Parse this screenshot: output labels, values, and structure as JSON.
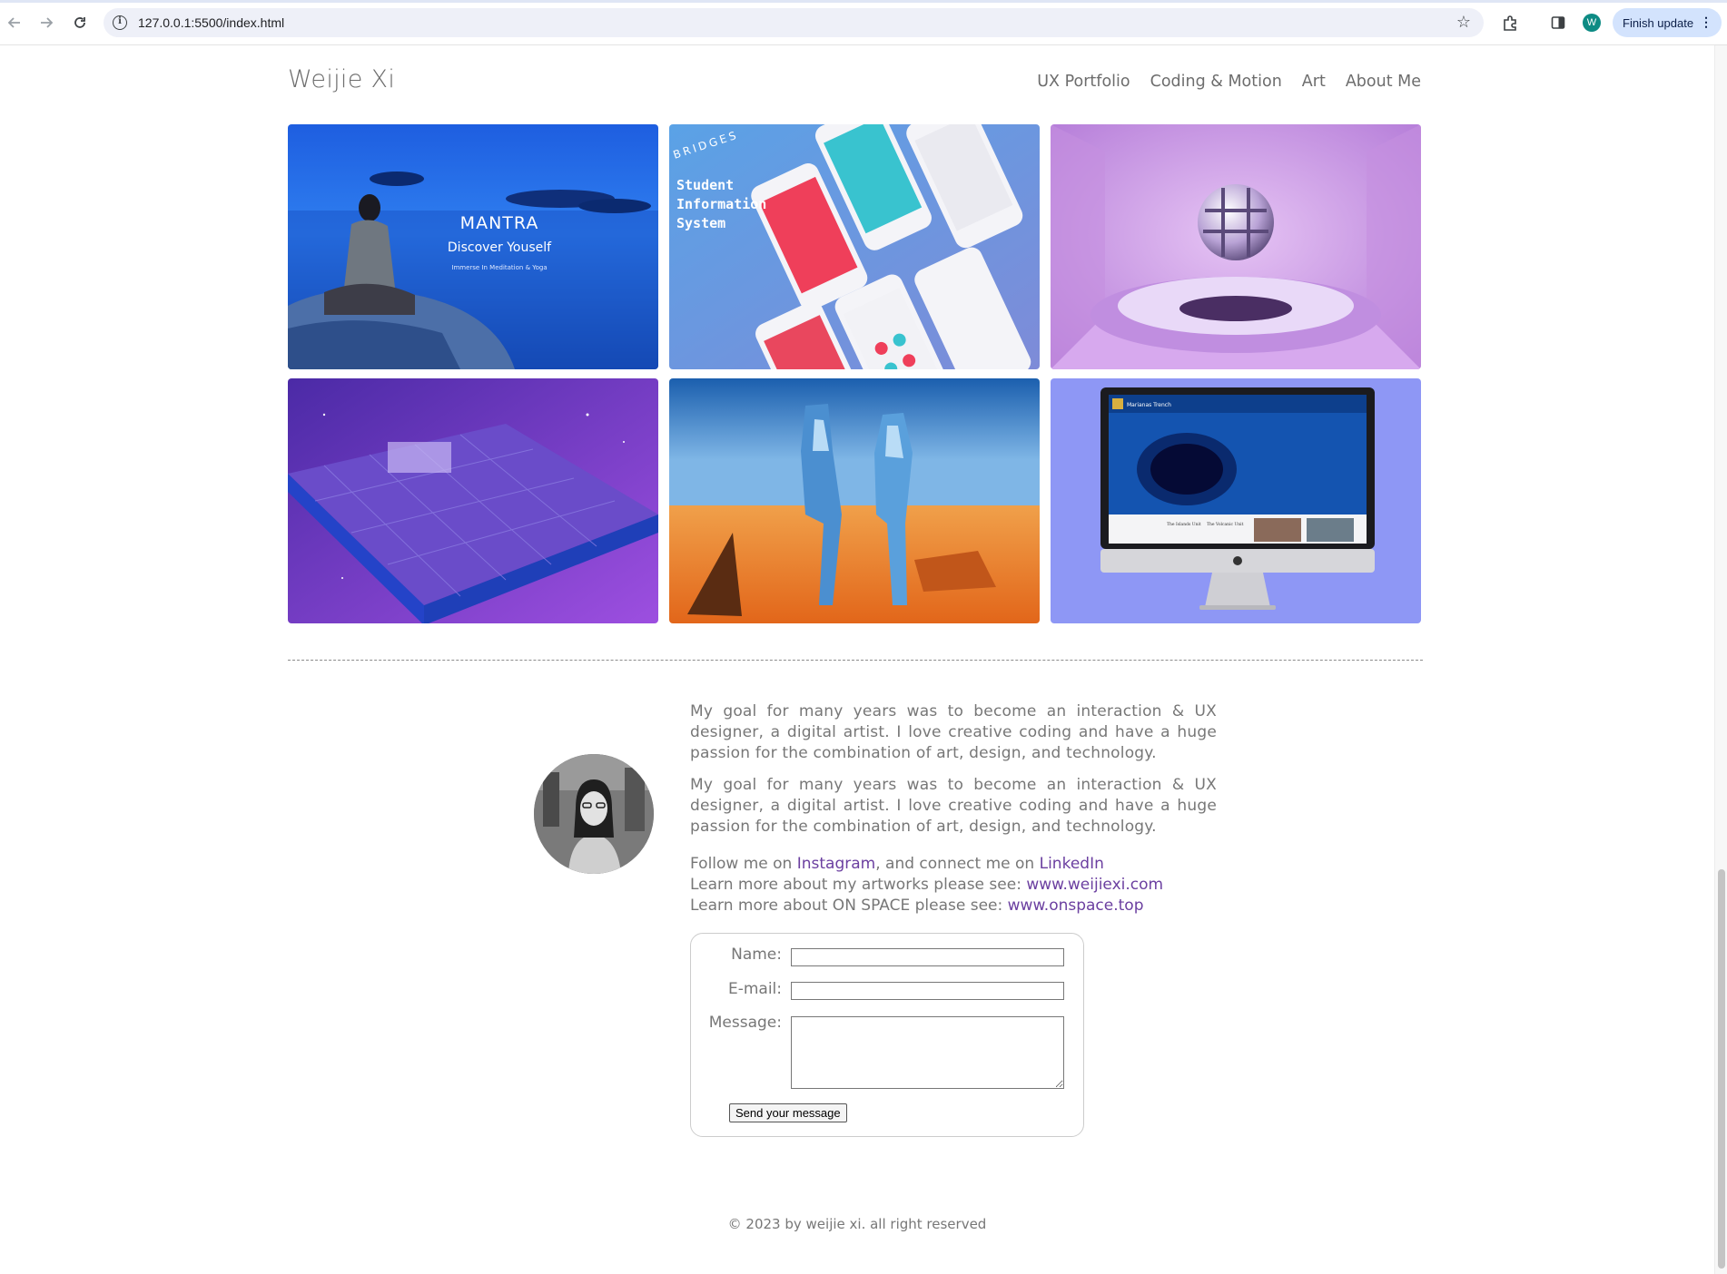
{
  "browser": {
    "url": "127.0.0.1:5500/index.html",
    "profile_initial": "W",
    "update_label": "Finish update"
  },
  "site": {
    "title": "Weijie Xi",
    "nav": [
      "UX Portfolio",
      "Coding & Motion",
      "Art",
      "About Me"
    ]
  },
  "gallery": {
    "mantra": {
      "brand": "MANTRA",
      "headline": "Discover Youself",
      "tagline": "Immerse In Meditation & Yoga"
    },
    "bridges": {
      "brand": "BRIDGES",
      "line1": "Student",
      "line2": "Information",
      "line3": "System"
    },
    "marianas": {
      "brand": "Marianas Trench",
      "caption1": "The Islands Unit",
      "caption2": "The Volcanic Unit"
    }
  },
  "about": {
    "paragraphs": [
      "My goal for many years was to become an interaction & UX designer, a digital artist. I love creative coding and have a huge passion for the combination of art, design, and technology.",
      "My goal for many years was to become an interaction & UX designer, a digital artist. I love creative coding and have a huge passion for the combination of art, design, and technology."
    ],
    "follow_prefix": "Follow me on ",
    "instagram": "Instagram",
    "connect_text": ", and connect me on ",
    "linkedin": "LinkedIn",
    "artworks_text": "Learn more about my artworks please see: ",
    "artworks_link": "www.weijiexi.com",
    "onspace_text": "Learn more about ON SPACE please see: ",
    "onspace_link": "www.onspace.top"
  },
  "contact": {
    "name_label": "Name:",
    "email_label": "E-mail:",
    "message_label": "Message:",
    "send_label": "Send your message"
  },
  "footer": {
    "text": "© 2023 by weijie xi. all right reserved"
  },
  "colors": {
    "link": "#6b3fa0",
    "text": "#777777",
    "update_pill": "#d3e3fd"
  }
}
